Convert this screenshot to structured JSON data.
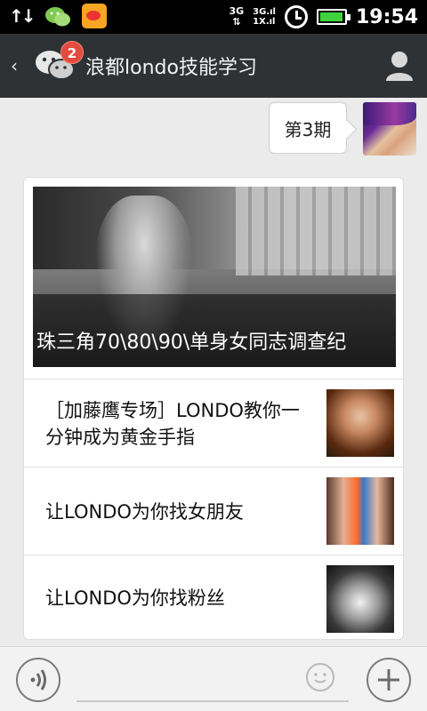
{
  "statusbar": {
    "network_type": "3G",
    "network_sub_top": "3G",
    "network_sub_bottom": "1X",
    "time": "19:54",
    "icons": [
      "data-transfer-icon",
      "wechat-notification-icon",
      "weibo-notification-icon",
      "signal-icon",
      "alarm-clock-icon",
      "battery-icon"
    ],
    "battery_level": 0.95
  },
  "titlebar": {
    "title": "浪都londo技能学习",
    "badge_count": "2",
    "back_icon": "‹",
    "colors": {
      "background": "#2f3235",
      "badge": "#e54b3d"
    }
  },
  "message": {
    "text": "第3期"
  },
  "news": {
    "hero_caption": "珠三角70\\80\\90\\单身女同志调查纪",
    "items": [
      {
        "text": "［加藤鹰专场］LONDO教你一分钟成为黄金手指"
      },
      {
        "text": "让LONDO为你找女朋友"
      },
      {
        "text": "让LONDO为你找粉丝"
      }
    ]
  },
  "bottombar": {
    "icons": [
      "voice-icon",
      "emoji-icon",
      "plus-icon"
    ]
  }
}
